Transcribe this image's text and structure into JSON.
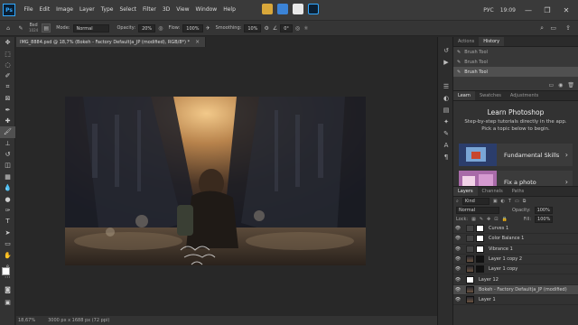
{
  "app": {
    "logo_text": "Ps",
    "menu": [
      "File",
      "Edit",
      "Image",
      "Layer",
      "Type",
      "Select",
      "Filter",
      "3D",
      "View",
      "Window",
      "Help"
    ],
    "window_right": {
      "lang": "РУС",
      "time": "19:09"
    }
  },
  "options": {
    "brush_size": "Bsd",
    "brush_sub": "1024",
    "mode_label": "Mode:",
    "mode_value": "Normal",
    "opacity_label": "Opacity:",
    "opacity_value": "20%",
    "flow_label": "Flow:",
    "flow_value": "100%",
    "smoothing_label": "Smoothing:",
    "smoothing_value": "10%",
    "angle_value": "0°"
  },
  "document": {
    "tab_title": "IMG_8884.psd @ 18,7% (Bokeh - Factory Default|a_JP (modified), RGB/8*) *",
    "status_zoom": "18,67%",
    "status_info": "3000 px x 1688 px (72 ppi)"
  },
  "history": {
    "tabs": [
      "Actions",
      "History"
    ],
    "active_tab": "History",
    "items": [
      {
        "label": "Brush Tool",
        "selected": false
      },
      {
        "label": "Brush Tool",
        "selected": false
      },
      {
        "label": "Brush Tool",
        "selected": true
      }
    ]
  },
  "learn": {
    "tabs": [
      "Learn",
      "Swatches",
      "Adjustments"
    ],
    "active_tab": "Learn",
    "title": "Learn Photoshop",
    "description": "Step-by-step tutorials directly in the app. Pick a topic below to begin.",
    "cards": [
      {
        "label": "Fundamental Skills"
      },
      {
        "label": "Fix a photo"
      }
    ]
  },
  "layers": {
    "tabs": [
      "Layers",
      "Channels",
      "Paths"
    ],
    "active_tab": "Layers",
    "kind_label": "Kind",
    "blend_mode": "Normal",
    "opacity_label": "Opacity:",
    "opacity_value": "100%",
    "lock_label": "Lock:",
    "fill_label": "Fill:",
    "fill_value": "100%",
    "items": [
      {
        "name": "Curves 1",
        "type": "adjustment",
        "selected": false
      },
      {
        "name": "Color Balance 1",
        "type": "adjustment",
        "selected": false
      },
      {
        "name": "Vibrance 1",
        "type": "adjustment",
        "selected": false
      },
      {
        "name": "Layer 1 copy 2",
        "type": "image",
        "selected": false
      },
      {
        "name": "Layer 1 copy",
        "type": "image",
        "selected": false
      },
      {
        "name": "Layer 12",
        "type": "blank",
        "selected": false
      },
      {
        "name": "Bokeh - Factory Default|a_JP (modified)",
        "type": "image",
        "selected": true
      },
      {
        "name": "Layer 1",
        "type": "image",
        "selected": false
      }
    ]
  },
  "colors": {
    "foreground": "#ffffff",
    "background": "#d7b27a",
    "accent": "#31a8ff"
  }
}
